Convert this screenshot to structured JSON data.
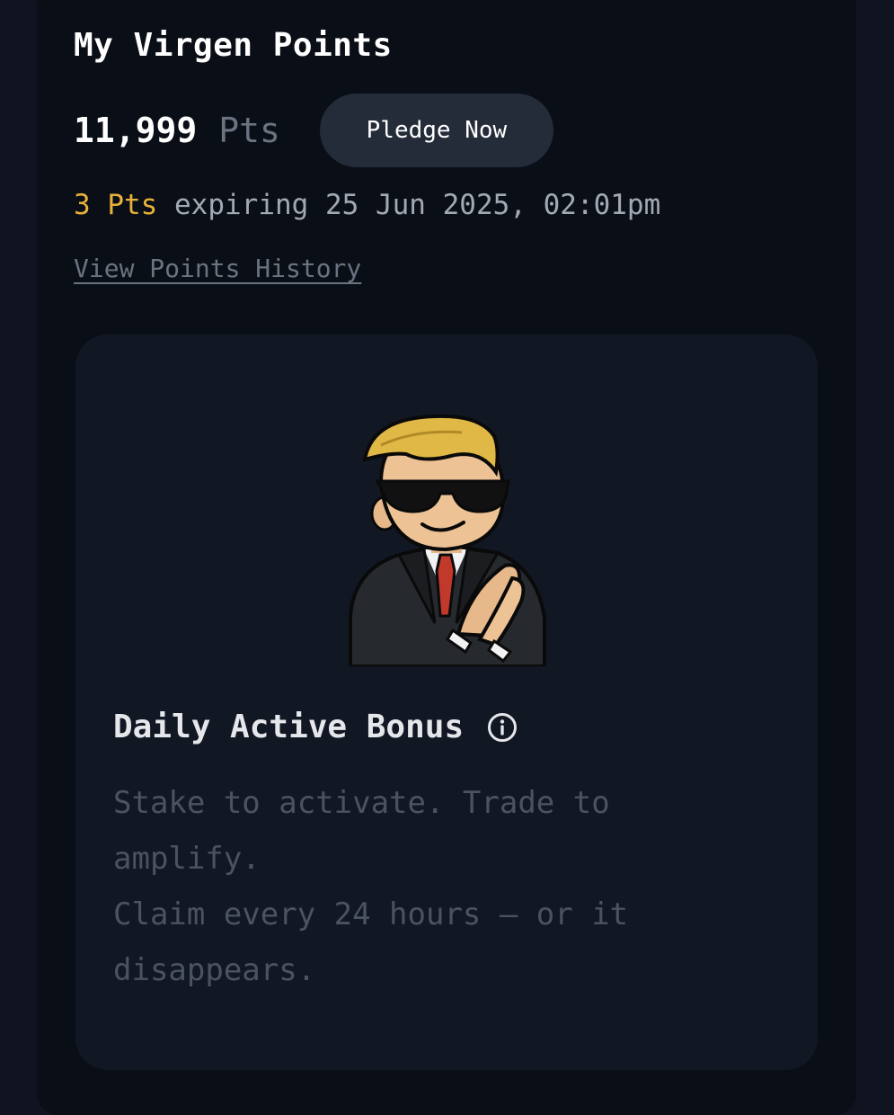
{
  "header": {
    "title": "My Virgen Points"
  },
  "points": {
    "value": "11,999",
    "unit": "Pts",
    "pledge_label": "Pledge Now"
  },
  "expiry": {
    "amount": "3 Pts",
    "text": "expiring 25 Jun 2025, 02:01pm"
  },
  "history_link": "View Points History",
  "bonus_card": {
    "mascot": "wsb-mascot-sunglasses-suit",
    "title": "Daily Active Bonus",
    "info_icon": "info-circle-icon",
    "desc_line1": "Stake to activate. Trade to amplify.",
    "desc_line2": "Claim every 24 hours — or it disappears."
  },
  "colors": {
    "background": "#0f1420",
    "panel": "#0a0e17",
    "card": "#121724",
    "accent": "#e8b13a",
    "button": "#252c39",
    "muted": "#6b7280"
  }
}
